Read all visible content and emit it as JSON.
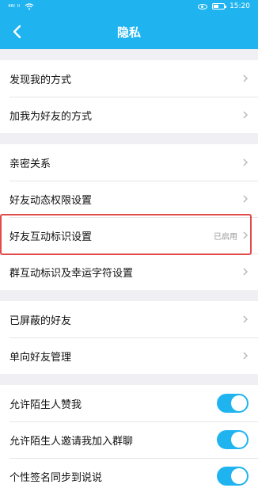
{
  "statusbar": {
    "left_text": "⁴⁶ᴵ ᴵᴵ",
    "wifi": "wifi-icon",
    "time": "15:20"
  },
  "header": {
    "title": "隐私",
    "back_icon": "back-arrow-icon"
  },
  "sections": [
    [
      {
        "label": "发现我的方式",
        "type": "nav"
      },
      {
        "label": "加我为好友的方式",
        "type": "nav"
      }
    ],
    [
      {
        "label": "亲密关系",
        "type": "nav"
      },
      {
        "label": "好友动态权限设置",
        "type": "nav"
      },
      {
        "label": "好友互动标识设置",
        "type": "nav",
        "value": "已启用"
      },
      {
        "label": "群互动标识及幸运字符设置",
        "type": "nav"
      }
    ],
    [
      {
        "label": "已屏蔽的好友",
        "type": "nav"
      },
      {
        "label": "单向好友管理",
        "type": "nav"
      }
    ],
    [
      {
        "label": "允许陌生人赞我",
        "type": "toggle",
        "on": true
      },
      {
        "label": "允许陌生人邀请我加入群聊",
        "type": "toggle",
        "on": true
      },
      {
        "label": "个性签名同步到说说",
        "type": "toggle",
        "on": true
      }
    ]
  ],
  "colors": {
    "accent": "#1fb4f0",
    "highlight_border": "#e24a4a"
  }
}
